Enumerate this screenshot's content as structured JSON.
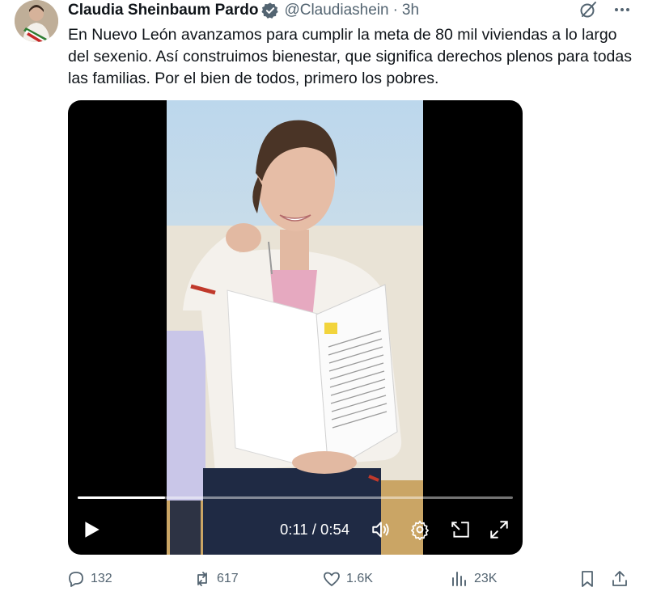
{
  "author": {
    "name": "Claudia Sheinbaum Pardo",
    "handle": "@Claudiashein",
    "separator": "·",
    "time": "3h"
  },
  "tweet": {
    "text": "En Nuevo León avanzamos para cumplir la meta de 80 mil viviendas a lo largo del sexenio. Así construimos bienestar, que significa derechos plenos para todas las familias. Por el bien de todos, primero los pobres."
  },
  "video": {
    "timecode": "0:11 / 0:54",
    "progress": 0.2
  },
  "actions": {
    "replies": "132",
    "reposts": "617",
    "likes": "1.6K",
    "views": "23K"
  },
  "colors": {
    "text": "#0f1419",
    "muted": "#536471",
    "verified": "#1d9bf0"
  }
}
